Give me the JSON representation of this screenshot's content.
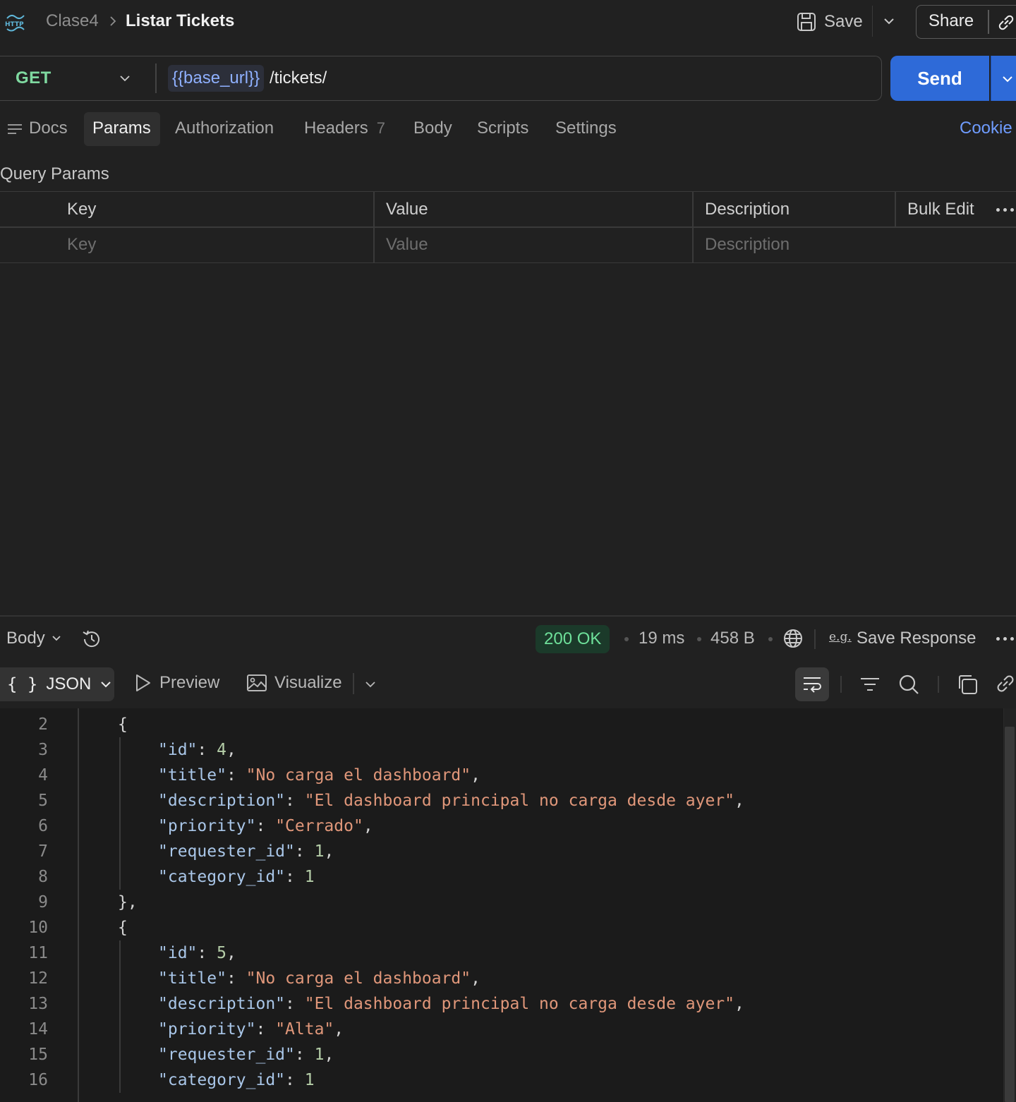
{
  "breadcrumb": {
    "icon": "http-icon",
    "parent": "Clase4",
    "current": "Listar Tickets"
  },
  "toolbar": {
    "save_label": "Save",
    "share_label": "Share"
  },
  "request": {
    "method": "GET",
    "url_variable": "{{base_url}}",
    "url_path": "/tickets/",
    "send_label": "Send"
  },
  "tabs": {
    "docs": "Docs",
    "params": "Params",
    "authorization": "Authorization",
    "headers": "Headers",
    "headers_count": "7",
    "body": "Body",
    "scripts": "Scripts",
    "settings": "Settings",
    "cookies": "Cookie",
    "active": "Params"
  },
  "query_params": {
    "title": "Query Params",
    "columns": {
      "key": "Key",
      "value": "Value",
      "description": "Description"
    },
    "placeholders": {
      "key": "Key",
      "value": "Value",
      "description": "Description"
    },
    "bulk_edit": "Bulk Edit"
  },
  "response": {
    "body_label": "Body",
    "status": "200 OK",
    "time": "19 ms",
    "size": "458 B",
    "example_icon": "e.g.",
    "save_response": "Save Response",
    "format": "JSON",
    "format_icon": "{ }",
    "preview": "Preview",
    "visualize": "Visualize",
    "status_color": "#6ee09a"
  },
  "code": {
    "lines": [
      {
        "n": "2",
        "indent": 1,
        "parts": [
          [
            "{",
            "punc"
          ]
        ]
      },
      {
        "n": "3",
        "indent": 2,
        "parts": [
          [
            "\"id\"",
            "key"
          ],
          [
            ": ",
            "punc"
          ],
          [
            "4",
            "num"
          ],
          [
            ",",
            "punc"
          ]
        ]
      },
      {
        "n": "4",
        "indent": 2,
        "parts": [
          [
            "\"title\"",
            "key"
          ],
          [
            ": ",
            "punc"
          ],
          [
            "\"No carga el dashboard\"",
            "str"
          ],
          [
            ",",
            "punc"
          ]
        ]
      },
      {
        "n": "5",
        "indent": 2,
        "parts": [
          [
            "\"description\"",
            "key"
          ],
          [
            ": ",
            "punc"
          ],
          [
            "\"El dashboard principal no carga desde ayer\"",
            "str"
          ],
          [
            ",",
            "punc"
          ]
        ]
      },
      {
        "n": "6",
        "indent": 2,
        "parts": [
          [
            "\"priority\"",
            "key"
          ],
          [
            ": ",
            "punc"
          ],
          [
            "\"Cerrado\"",
            "str"
          ],
          [
            ",",
            "punc"
          ]
        ]
      },
      {
        "n": "7",
        "indent": 2,
        "parts": [
          [
            "\"requester_id\"",
            "key"
          ],
          [
            ": ",
            "punc"
          ],
          [
            "1",
            "num"
          ],
          [
            ",",
            "punc"
          ]
        ]
      },
      {
        "n": "8",
        "indent": 2,
        "parts": [
          [
            "\"category_id\"",
            "key"
          ],
          [
            ": ",
            "punc"
          ],
          [
            "1",
            "num"
          ]
        ]
      },
      {
        "n": "9",
        "indent": 1,
        "parts": [
          [
            "},",
            "punc"
          ]
        ]
      },
      {
        "n": "10",
        "indent": 1,
        "parts": [
          [
            "{",
            "punc"
          ]
        ]
      },
      {
        "n": "11",
        "indent": 2,
        "parts": [
          [
            "\"id\"",
            "key"
          ],
          [
            ": ",
            "punc"
          ],
          [
            "5",
            "num"
          ],
          [
            ",",
            "punc"
          ]
        ]
      },
      {
        "n": "12",
        "indent": 2,
        "parts": [
          [
            "\"title\"",
            "key"
          ],
          [
            ": ",
            "punc"
          ],
          [
            "\"No carga el dashboard\"",
            "str"
          ],
          [
            ",",
            "punc"
          ]
        ]
      },
      {
        "n": "13",
        "indent": 2,
        "parts": [
          [
            "\"description\"",
            "key"
          ],
          [
            ": ",
            "punc"
          ],
          [
            "\"El dashboard principal no carga desde ayer\"",
            "str"
          ],
          [
            ",",
            "punc"
          ]
        ]
      },
      {
        "n": "14",
        "indent": 2,
        "parts": [
          [
            "\"priority\"",
            "key"
          ],
          [
            ": ",
            "punc"
          ],
          [
            "\"Alta\"",
            "str"
          ],
          [
            ",",
            "punc"
          ]
        ]
      },
      {
        "n": "15",
        "indent": 2,
        "parts": [
          [
            "\"requester_id\"",
            "key"
          ],
          [
            ": ",
            "punc"
          ],
          [
            "1",
            "num"
          ],
          [
            ",",
            "punc"
          ]
        ]
      },
      {
        "n": "16",
        "indent": 2,
        "parts": [
          [
            "\"category_id\"",
            "key"
          ],
          [
            ": ",
            "punc"
          ],
          [
            "1",
            "num"
          ]
        ]
      }
    ]
  }
}
